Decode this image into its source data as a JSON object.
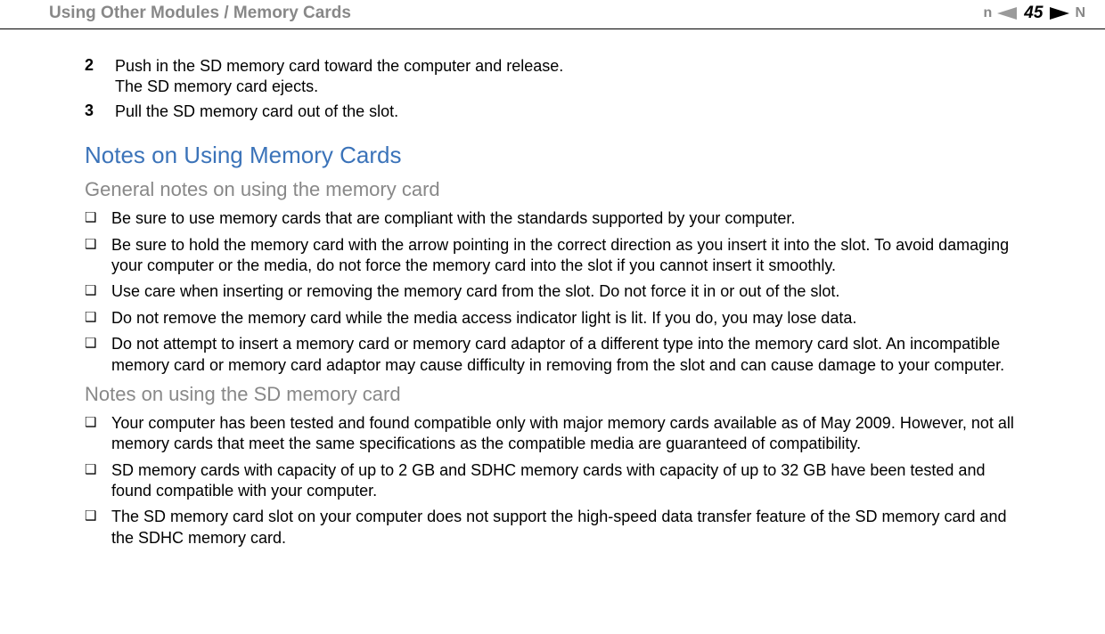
{
  "header": {
    "breadcrumb": "Using Other Modules / Memory Cards",
    "page_number": "45",
    "nav_n_left": "n",
    "nav_n_right": "N"
  },
  "steps": [
    {
      "num": "2",
      "text_line1": "Push in the SD memory card toward the computer and release.",
      "text_line2": "The SD memory card ejects."
    },
    {
      "num": "3",
      "text_line1": "Pull the SD memory card out of the slot.",
      "text_line2": ""
    }
  ],
  "section_title": "Notes on Using Memory Cards",
  "subsection1_title": "General notes on using the memory card",
  "general_notes": [
    "Be sure to use memory cards that are compliant with the standards supported by your computer.",
    "Be sure to hold the memory card with the arrow pointing in the correct direction as you insert it into the slot. To avoid damaging your computer or the media, do not force the memory card into the slot if you cannot insert it smoothly.",
    "Use care when inserting or removing the memory card from the slot. Do not force it in or out of the slot.",
    "Do not remove the memory card while the media access indicator light is lit. If you do, you may lose data.",
    "Do not attempt to insert a memory card or memory card adaptor of a different type into the memory card slot. An incompatible memory card or memory card adaptor may cause difficulty in removing from the slot and can cause damage to your computer."
  ],
  "subsection2_title": "Notes on using the SD memory card",
  "sd_notes": [
    "Your computer has been tested and found compatible only with major memory cards available as of May 2009. However, not all memory cards that meet the same specifications as the compatible media are guaranteed of compatibility.",
    "SD memory cards with capacity of up to 2 GB and SDHC memory cards with capacity of up to 32 GB have been tested and found compatible with your computer.",
    "The SD memory card slot on your computer does not support the high-speed data transfer feature of the SD memory card and the SDHC memory card."
  ],
  "bullet_glyph": "❑"
}
